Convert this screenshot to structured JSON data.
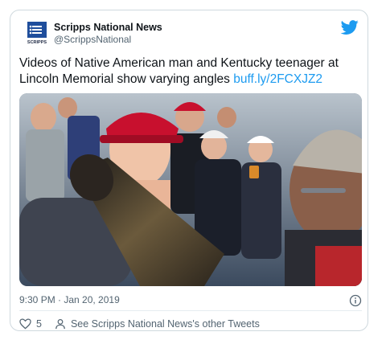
{
  "author": {
    "display_name": "Scripps National News",
    "handle": "@ScrippsNational",
    "avatar_text": "SCRIPPS"
  },
  "tweet": {
    "text": "Videos of Native American man and Kentucky teenager at Lincoln Memorial show varying angles ",
    "link_text": "buff.ly/2FCXJZ2",
    "timestamp": "9:30 PM · Jan 20, 2019"
  },
  "actions": {
    "like_count": "5",
    "profile_link": "See Scripps National News's other Tweets"
  },
  "icons": {
    "brand": "twitter-bird-icon",
    "info": "info-icon",
    "like": "heart-icon",
    "profile": "person-icon"
  },
  "colors": {
    "link": "#1d9bf0",
    "twitter_blue": "#1d9bf0",
    "muted": "#536471",
    "border": "#cfd9de"
  }
}
